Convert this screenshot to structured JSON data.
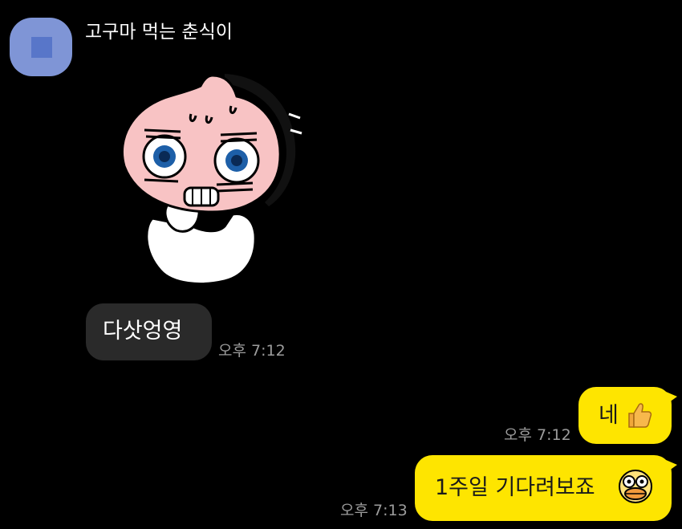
{
  "chat": {
    "sender": {
      "name": "고구마 먹는 춘식이"
    },
    "messages": [
      {
        "type": "sticker",
        "direction": "in",
        "sticker_icon": "sweating-peach-character-sticker"
      },
      {
        "type": "text",
        "direction": "in",
        "text": "다삿엉영",
        "time": "오후 7:12"
      },
      {
        "type": "text",
        "direction": "out",
        "text": "네",
        "emoji_icon": "thumbs-up-icon",
        "time": "오후 7:12"
      },
      {
        "type": "text",
        "direction": "out",
        "text": "1주일 기다려보죠",
        "emoji_icon": "shocked-duck-face-icon",
        "time": "오후 7:13"
      }
    ]
  },
  "colors": {
    "background": "#000000",
    "incoming_bubble": "#2a2a2a",
    "outgoing_bubble": "#fee500",
    "timestamp": "#9c9c9c",
    "avatar": "#7f95d6"
  }
}
